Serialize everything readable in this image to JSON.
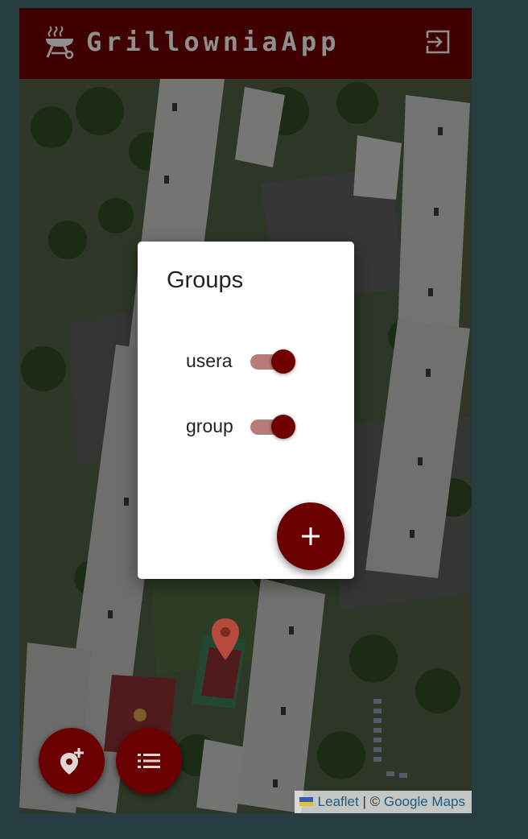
{
  "app": {
    "title": "GrillowniaApp",
    "logo_icon": "grill-icon",
    "logout_icon": "logout-icon",
    "bar_color": "#3f0000",
    "accent_color": "#6b0000"
  },
  "groups_dialog": {
    "title": "Groups",
    "groups": [
      {
        "label": "usera",
        "enabled": true
      },
      {
        "label": "group",
        "enabled": true
      }
    ],
    "add_icon": "plus-icon"
  },
  "map": {
    "marker_icon": "map-pin-icon",
    "attribution": {
      "leaflet": "Leaflet",
      "separator": "|",
      "copyright": "©",
      "provider": "Google Maps"
    }
  },
  "actions": {
    "add_place_icon": "add-location-icon",
    "list_icon": "list-icon"
  }
}
